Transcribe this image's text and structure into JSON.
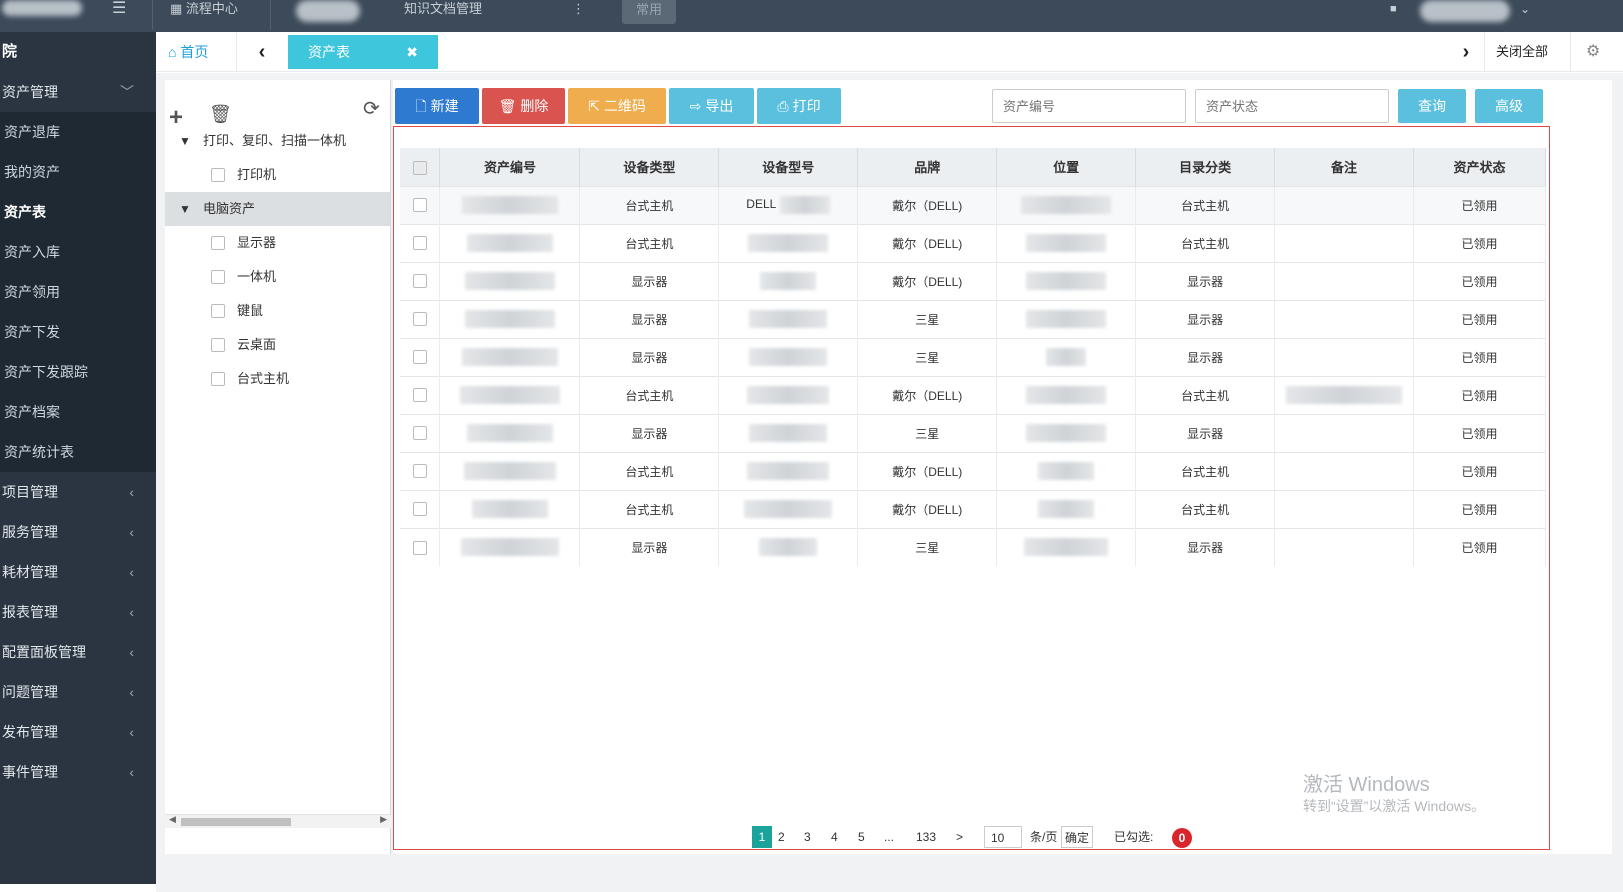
{
  "topbar": {
    "items": [
      "流程中心",
      "知识文档管理",
      "常用"
    ]
  },
  "sidebar": {
    "brand": "院",
    "asset_group": "资产管理",
    "asset_items": [
      "资产退库",
      "我的资产",
      "资产表",
      "资产入库",
      "资产领用",
      "资产下发",
      "资产下发跟踪",
      "资产档案",
      "资产统计表"
    ],
    "groups": [
      "项目管理",
      "服务管理",
      "耗材管理",
      "报表管理",
      "配置面板管理",
      "问题管理",
      "发布管理",
      "事件管理"
    ]
  },
  "tabs": {
    "home": "首页",
    "active": "资产表",
    "close_all": "关闭全部"
  },
  "tree": {
    "nodes": [
      {
        "label": "打印、复印、扫描一体机",
        "children": [
          "打印机"
        ]
      },
      {
        "label": "电脑资产",
        "children": [
          "显示器",
          "一体机",
          "键鼠",
          "云桌面",
          "台式主机"
        ]
      }
    ]
  },
  "toolbar": {
    "new": "新建",
    "delete": "删除",
    "qrcode": "二维码",
    "export": "导出",
    "print": "打印",
    "search_code_placeholder": "资产编号",
    "search_status_placeholder": "资产状态",
    "query": "查询",
    "advanced": "高级"
  },
  "table": {
    "columns": [
      "资产编号",
      "设备类型",
      "设备型号",
      "品牌",
      "位置",
      "目录分类",
      "备注",
      "资产状态"
    ],
    "rows": [
      {
        "type": "台式主机",
        "model": "DELL",
        "brand": "戴尔（DELL)",
        "category": "台式主机",
        "status": "已领用"
      },
      {
        "type": "台式主机",
        "model": "",
        "brand": "戴尔（DELL)",
        "category": "台式主机",
        "status": "已领用"
      },
      {
        "type": "显示器",
        "model": "",
        "brand": "戴尔（DELL)",
        "category": "显示器",
        "status": "已领用"
      },
      {
        "type": "显示器",
        "model": "",
        "brand": "三星",
        "category": "显示器",
        "status": "已领用"
      },
      {
        "type": "显示器",
        "model": "",
        "brand": "三星",
        "category": "显示器",
        "status": "已领用"
      },
      {
        "type": "台式主机",
        "model": "",
        "brand": "戴尔（DELL)",
        "category": "台式主机",
        "status": "已领用"
      },
      {
        "type": "显示器",
        "model": "",
        "brand": "三星",
        "category": "显示器",
        "status": "已领用"
      },
      {
        "type": "台式主机",
        "model": "",
        "brand": "戴尔（DELL)",
        "category": "台式主机",
        "status": "已领用"
      },
      {
        "type": "台式主机",
        "model": "",
        "brand": "戴尔（DELL)",
        "category": "台式主机",
        "status": "已领用"
      },
      {
        "type": "显示器",
        "model": "",
        "brand": "三星",
        "category": "显示器",
        "status": "已领用"
      }
    ]
  },
  "pager": {
    "pages": [
      "1",
      "2",
      "3",
      "4",
      "5",
      "...",
      "133",
      ">"
    ],
    "page_size": "10",
    "per_page_label": "条/页",
    "confirm": "确定",
    "selected_label": "已勾选:",
    "selected_count": "0"
  },
  "watermark": {
    "line1": "激活 Windows",
    "line2": "转到“设置”以激活 Windows。"
  },
  "colors": {
    "sidebar_bg": "#2a3541",
    "tab_active": "#3ec7dc",
    "btn_primary": "#2e7ad1",
    "btn_danger": "#d9534f",
    "btn_warning": "#f0ad4e",
    "btn_info": "#5bc0de"
  }
}
